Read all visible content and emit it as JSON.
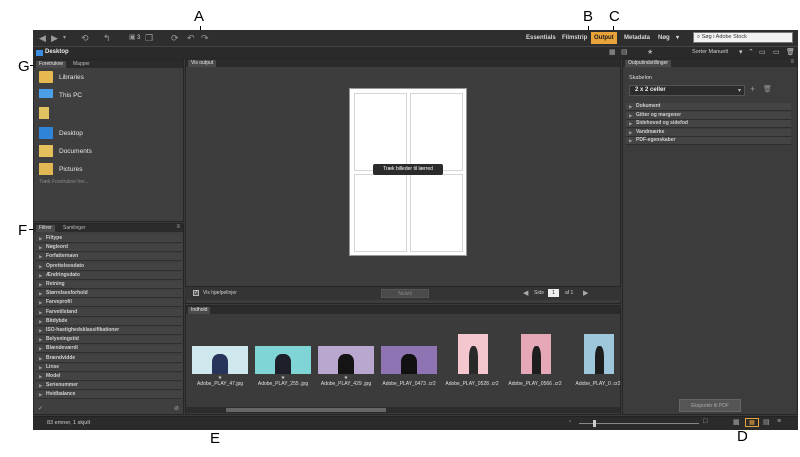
{
  "callouts": {
    "a": "A",
    "b": "B",
    "c": "C",
    "d": "D",
    "e": "E",
    "f": "F",
    "g": "G"
  },
  "toolbar": {
    "workspaces": [
      "Essentials",
      "Filmstrip",
      "Output",
      "Metadata",
      "Nøg"
    ],
    "active_workspace": "Output",
    "search_placeholder": "Søg i Adobe Stock",
    "path": "Desktop",
    "sort_label": "Sorter Manuelt",
    "count_badge": "3"
  },
  "left": {
    "tabs": [
      "Foretrukne",
      "Mapper"
    ],
    "favorites": [
      "Libraries",
      "This PC",
      "",
      "Desktop",
      "Documents",
      "Pictures"
    ],
    "drag_hint": "Træk Foretrukne her...",
    "filter_tabs": [
      "Filtrer",
      "Samlinger"
    ],
    "filters": [
      "Filtype",
      "Nøgleord",
      "Forfatternavn",
      "Oprettelsesdato",
      "Ændringsdato",
      "Retning",
      "Størrelsesforhold",
      "Farveprofil",
      "Farvetilstand",
      "Bitdybde",
      "ISO-hastighedsklassifikationer",
      "Belysningstid",
      "Blændeværdi",
      "Brændvidde",
      "Linse",
      "Model",
      "Serienummer",
      "Hvidbalance"
    ]
  },
  "center": {
    "tab": "Vis output",
    "drag_tip": "Træk billeder til lærred",
    "show_guides": "Vis hjælpelinjer",
    "refresh": "Nulstil",
    "page_label": "Side",
    "page_value": "1",
    "page_of": "af 1"
  },
  "content": {
    "tab": "Indhold",
    "items": [
      {
        "name": "Adobe_PLAY_47.jpg",
        "star": "★",
        "bg": "#cfe8ee",
        "fg": "#28345a"
      },
      {
        "name": "Adobe_PLAY_255 .jpg",
        "star": "★",
        "bg": "#7fd4d6",
        "fg": "#1d1f2a"
      },
      {
        "name": "Adobe_PLAY_429 .jpg",
        "star": "★",
        "bg": "#b9a7cf",
        "fg": "#141414"
      },
      {
        "name": "Adobe_PLAY_0473 .cr2",
        "star": "",
        "bg": "#8f74b3",
        "fg": "#111111"
      },
      {
        "name": "Adobe_PLAY_0528 .cr2",
        "star": "",
        "bg": "#f4c7cf",
        "fg": "#2a2a2a"
      },
      {
        "name": "Adobe_PLAY_0566 .cr2",
        "star": "",
        "bg": "#e6a7b7",
        "fg": "#1e1e1e"
      },
      {
        "name": "Adobe_PLAY_0 .cr2",
        "star": "",
        "bg": "#9fc7dc",
        "fg": "#1e1e1e"
      }
    ]
  },
  "output": {
    "tab": "Outputindstillinger",
    "template_label": "Skabelon",
    "template_value": "2 x 2 celler",
    "sections": [
      "Dokument",
      "Gitter og margener",
      "Sidehoved og sidefod",
      "Vandmærke",
      "PDF-egenskaber"
    ],
    "export_button": "Eksportér til PDF"
  },
  "status": {
    "count": "83 emner, 1 skjult"
  },
  "colors": {
    "accent": "#e8a33b"
  }
}
